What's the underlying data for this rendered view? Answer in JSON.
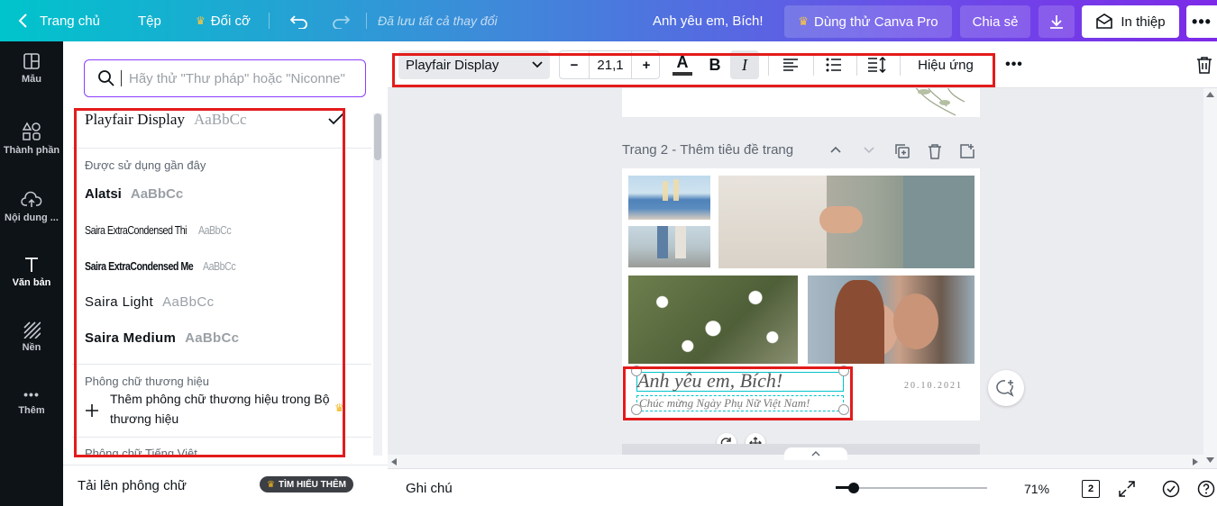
{
  "topbar": {
    "home": "Trang chủ",
    "file": "Tệp",
    "resize": "Đổi cỡ",
    "saved_status": "Đã lưu tất cả thay đổi",
    "design_title": "Anh yêu em, Bích!",
    "try_pro": "Dùng thử Canva Pro",
    "share": "Chia sẻ",
    "print": "In thiệp"
  },
  "sidebar": {
    "items": [
      {
        "label": "Mẫu"
      },
      {
        "label": "Thành phần"
      },
      {
        "label": "Nội dung ..."
      },
      {
        "label": "Văn bản"
      },
      {
        "label": "Nền"
      },
      {
        "label": "Thêm"
      }
    ]
  },
  "font_panel": {
    "search_placeholder": "Hãy thử \"Thư pháp\" hoặc \"Niconne\"",
    "selected_font": {
      "name": "Playfair Display",
      "sample": "AaBbCc"
    },
    "recent_label": "Được sử dụng gần đây",
    "recent_fonts": [
      {
        "name": "Alatsi",
        "sample": "AaBbCc"
      },
      {
        "name": "Saira ExtraCondensed Thi",
        "sample": "AaBbCc"
      },
      {
        "name": "Saira ExtraCondensed Me",
        "sample": "AaBbCc"
      },
      {
        "name": "Saira Light",
        "sample": "AaBbCc"
      },
      {
        "name": "Saira Medium",
        "sample": "AaBbCc"
      }
    ],
    "brand_label": "Phông chữ thương hiệu",
    "brand_add": "Thêm phông chữ thương hiệu trong Bộ thương hiệu",
    "vietnamese_label": "Phông chữ Tiếng Việt",
    "upload": "Tải lên phông chữ",
    "learn_more": "TÌM HIỂU THÊM"
  },
  "toolbar": {
    "font_name": "Playfair Display",
    "font_size": "21,1",
    "minus": "−",
    "plus": "+",
    "bold": "B",
    "italic": "I",
    "effects": "Hiệu ứng"
  },
  "canvas": {
    "page2_title": "Trang 2 - Thêm tiêu đề trang",
    "heading": "Anh yêu em, Bích!",
    "subheading": "Chúc mừng Ngày Phụ Nữ Việt Nam!",
    "date": "20.10.2021"
  },
  "bottom": {
    "notes": "Ghi chú",
    "zoom": "71%",
    "zoom_level": 0.12,
    "page_count": "2"
  },
  "colors": {
    "accent": "#8b3dff",
    "highlight_box": "#e31b1b",
    "selection": "#00c4cc"
  }
}
